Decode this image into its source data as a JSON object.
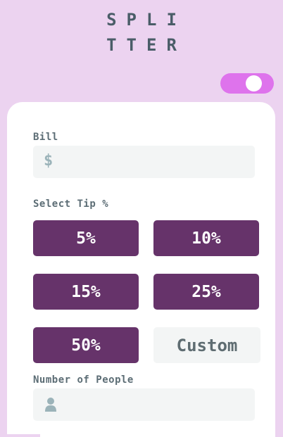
{
  "app": {
    "logo_line1": "SPLI",
    "logo_line2": "TTER"
  },
  "bill": {
    "label": "Bill",
    "prefix": "$",
    "value": ""
  },
  "tip": {
    "label": "Select Tip %",
    "options": [
      "5%",
      "10%",
      "15%",
      "25%",
      "50%"
    ],
    "custom_label": "Custom"
  },
  "people": {
    "label": "Number of People",
    "value": "",
    "icon": "person-icon"
  },
  "colors": {
    "background": "#ecd3f0",
    "accent": "#66336a",
    "toggle": "#de73ec",
    "input_bg": "#f3f5f5"
  }
}
